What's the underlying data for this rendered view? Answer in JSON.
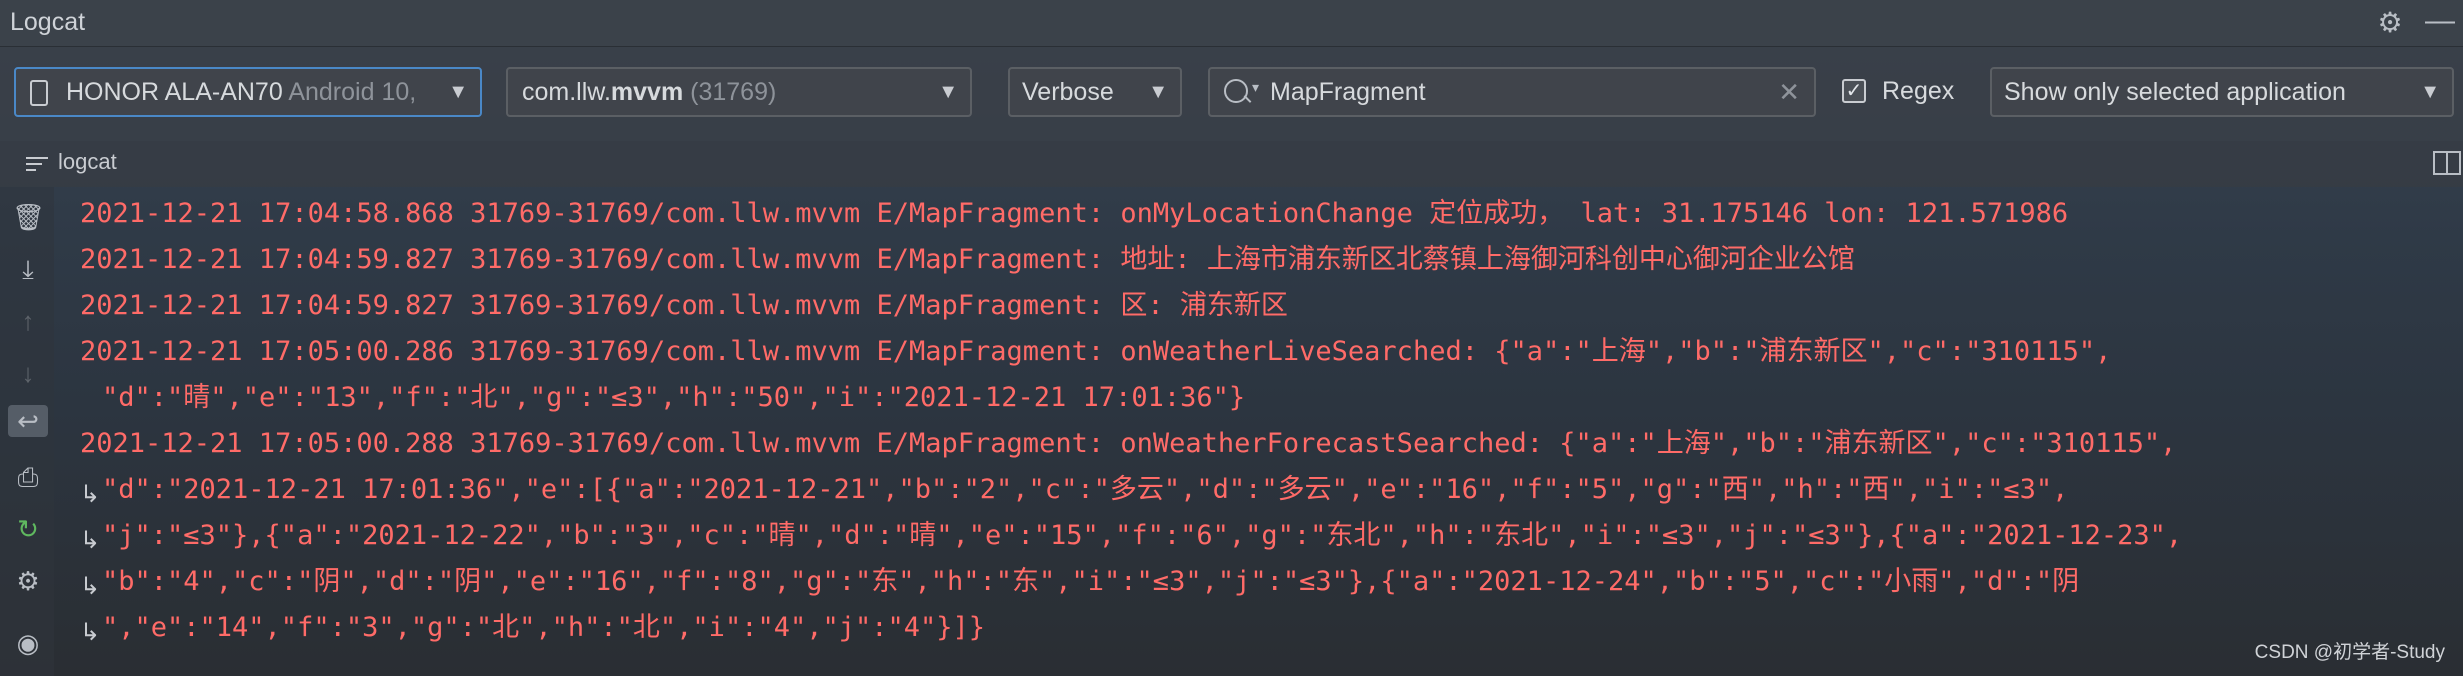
{
  "window": {
    "title": "Logcat"
  },
  "toolbar": {
    "device_name": "HONOR ALA-AN70",
    "device_version": "Android 10,",
    "package_prefix": "com.llw.",
    "package_bold": "mvvm",
    "package_pid": "(31769)",
    "log_level": "Verbose",
    "search_value": "MapFragment",
    "regex_label": "Regex",
    "regex_checked": true,
    "filter_option": "Show only selected application"
  },
  "tab": {
    "label": "logcat"
  },
  "log_lines": [
    {
      "text": "2021-12-21 17:04:58.868 31769-31769/com.llw.mvvm E/MapFragment: onMyLocationChange 定位成功， lat: 31.175146 lon: 121.571986"
    },
    {
      "text": "2021-12-21 17:04:59.827 31769-31769/com.llw.mvvm E/MapFragment: 地址: 上海市浦东新区北蔡镇上海御河科创中心御河企业公馆"
    },
    {
      "text": "2021-12-21 17:04:59.827 31769-31769/com.llw.mvvm E/MapFragment: 区: 浦东新区"
    },
    {
      "text": "2021-12-21 17:05:00.286 31769-31769/com.llw.mvvm E/MapFragment: onWeatherLiveSearched: {\"a\":\"上海\",\"b\":\"浦东新区\",\"c\":\"310115\","
    },
    {
      "text": "\"d\":\"晴\",\"e\":\"13\",\"f\":\"北\",\"g\":\"≤3\",\"h\":\"50\",\"i\":\"2021-12-21 17:01:36\"}"
    },
    {
      "text": "2021-12-21 17:05:00.288 31769-31769/com.llw.mvvm E/MapFragment: onWeatherForecastSearched: {\"a\":\"上海\",\"b\":\"浦东新区\",\"c\":\"310115\","
    },
    {
      "text": "\"d\":\"2021-12-21 17:01:36\",\"e\":[{\"a\":\"2021-12-21\",\"b\":\"2\",\"c\":\"多云\",\"d\":\"多云\",\"e\":\"16\",\"f\":\"5\",\"g\":\"西\",\"h\":\"西\",\"i\":\"≤3\","
    },
    {
      "text": "\"j\":\"≤3\"},{\"a\":\"2021-12-22\",\"b\":\"3\",\"c\":\"晴\",\"d\":\"晴\",\"e\":\"15\",\"f\":\"6\",\"g\":\"东北\",\"h\":\"东北\",\"i\":\"≤3\",\"j\":\"≤3\"},{\"a\":\"2021-12-23\","
    },
    {
      "text": "\"b\":\"4\",\"c\":\"阴\",\"d\":\"阴\",\"e\":\"16\",\"f\":\"8\",\"g\":\"东\",\"h\":\"东\",\"i\":\"≤3\",\"j\":\"≤3\"},{\"a\":\"2021-12-24\",\"b\":\"5\",\"c\":\"小雨\",\"d\":\"阴"
    },
    {
      "text": "\",\"e\":\"14\",\"f\":\"3\",\"g\":\"北\",\"h\":\"北\",\"i\":\"4\",\"j\":\"4\"}]}"
    }
  ],
  "watermark": "CSDN @初学者-Study",
  "colors": {
    "error_text": "#ff6b68",
    "selected_border": "#4a88c7"
  },
  "icons": [
    "settings-gear-icon",
    "minimize-icon",
    "phone-icon",
    "dropdown-arrow-icon",
    "search-icon",
    "clear-icon",
    "checkbox-icon",
    "list-icon",
    "layout-icon",
    "trash-icon",
    "scroll-to-end-icon",
    "up-arrow-icon",
    "down-arrow-icon",
    "soft-wrap-icon",
    "print-icon",
    "restart-icon",
    "settings-icon",
    "screenshot-icon"
  ]
}
